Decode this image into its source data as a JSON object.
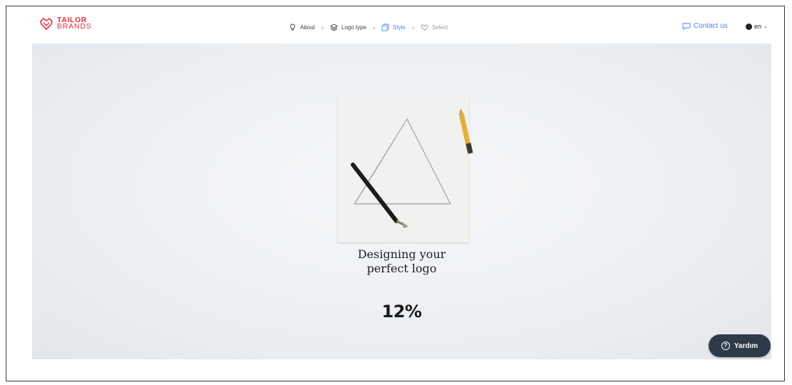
{
  "brand": {
    "line1": "TAILOR",
    "line2": "BRANDS",
    "color": "#e0323e"
  },
  "steps": [
    {
      "label": "About",
      "icon": "bulb-icon",
      "state": "done"
    },
    {
      "label": "Logo type",
      "icon": "layers-icon",
      "state": "done"
    },
    {
      "label": "Style",
      "icon": "style-icon",
      "state": "active"
    },
    {
      "label": "Select",
      "icon": "heart-icon",
      "state": "pending"
    }
  ],
  "step_separator": "›",
  "header": {
    "contact_label": "Contact us",
    "language": "en"
  },
  "loading": {
    "headline_line1": "Designing your",
    "headline_line2": "perfect logo",
    "progress_text": "12%",
    "progress_value": 0.12
  },
  "help": {
    "label": "Yardım",
    "icon_glyph": "?"
  },
  "colors": {
    "accent": "#4a7ff0",
    "help_bg": "#2f3a48"
  }
}
